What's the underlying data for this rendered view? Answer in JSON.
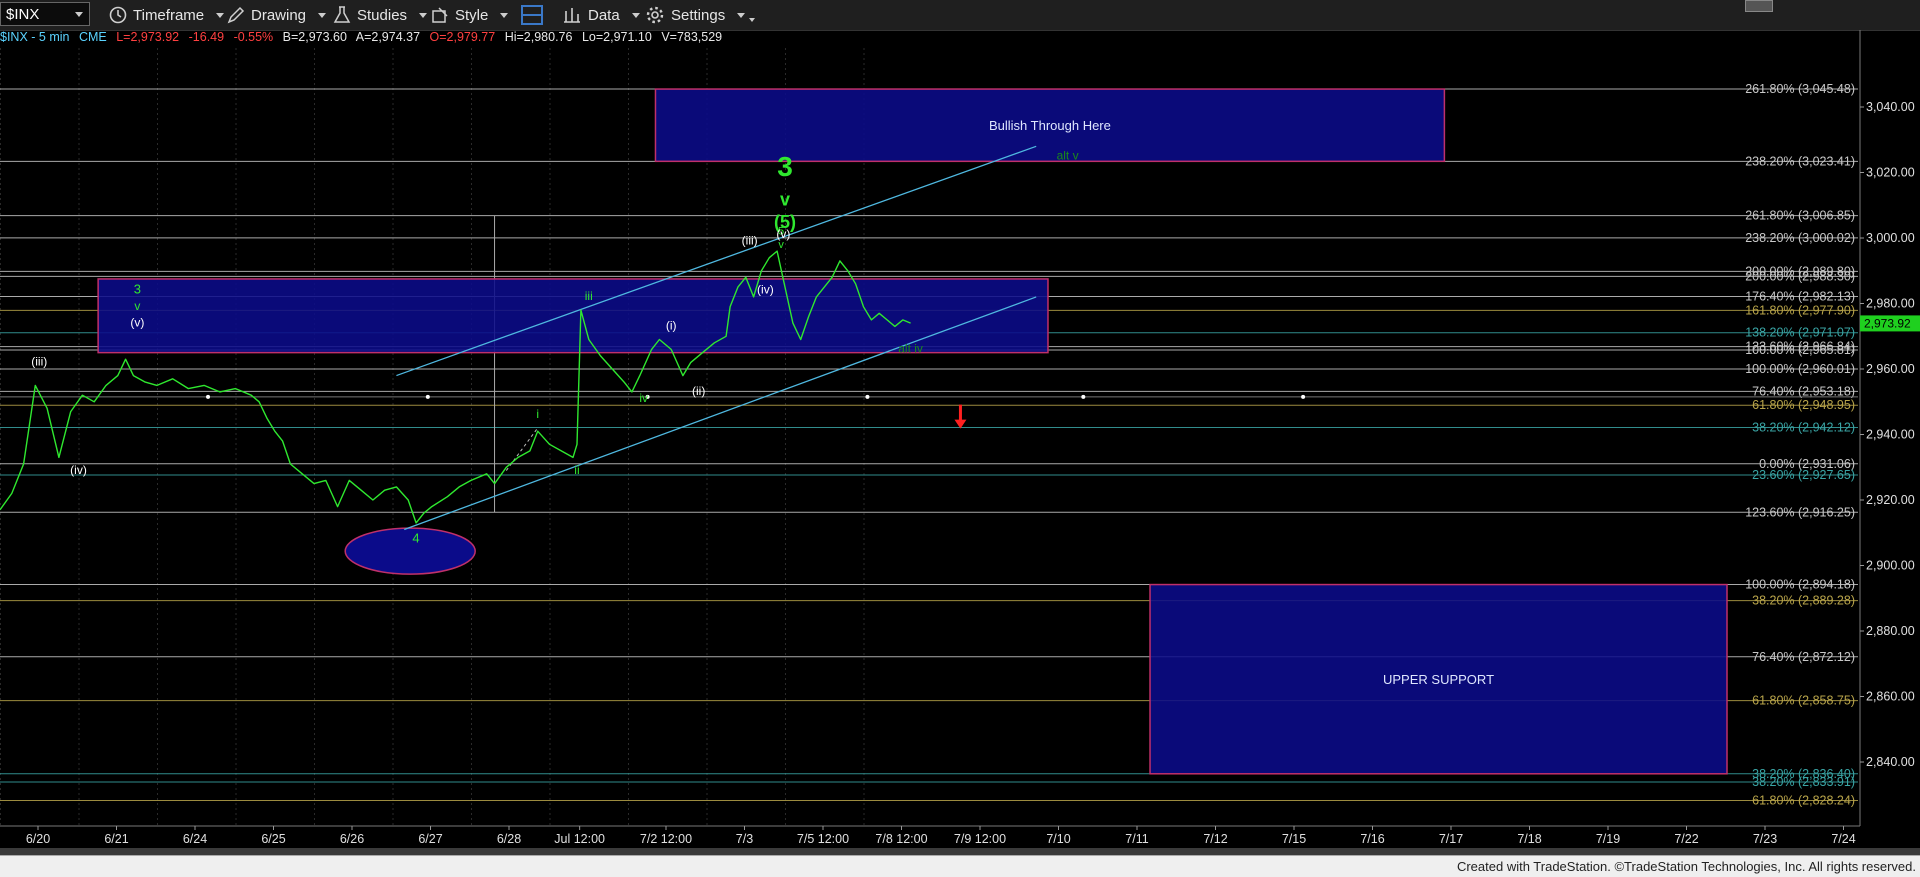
{
  "toolbar": {
    "symbol": "$INX",
    "timeframe": "Timeframe",
    "drawing": "Drawing",
    "studies": "Studies",
    "style": "Style",
    "data": "Data",
    "settings": "Settings"
  },
  "infobar": {
    "title": "$INX - 5 min",
    "exchange": "CME",
    "last": "L=2,973.92",
    "change": "-16.49",
    "pct": "-0.55%",
    "bid": "B=2,973.60",
    "ask": "A=2,974.37",
    "open": "O=2,979.77",
    "high": "Hi=2,980.76",
    "low": "Lo=2,971.10",
    "volume": "V=783,529"
  },
  "footer": {
    "credit": "Created with TradeStation. ©TradeStation Technologies, Inc. All rights reserved."
  },
  "colors": {
    "bg": "#000000",
    "price": "#2fe82f",
    "box": "#0b0b8a",
    "boxBorder": "#c0306a",
    "channel": "#4fb8e0",
    "last": "#1fd01f",
    "down": "#ff2020"
  },
  "chart_data": {
    "type": "line",
    "title": "$INX - 5 min",
    "ylim": [
      2826,
      3060
    ],
    "y_ticks": [
      3040,
      3020,
      3000,
      2980,
      2960,
      2940,
      2920,
      2900,
      2880,
      2860,
      2840
    ],
    "y_tick_labels": [
      "3,040.00",
      "3,020.00",
      "3,000.00",
      "2,980.00",
      "2,960.00",
      "2,940.00",
      "2,920.00",
      "2,900.00",
      "2,880.00",
      "2,860.00",
      "2,840.00"
    ],
    "x_ticks": [
      {
        "t": 0.5,
        "label": "6/20"
      },
      {
        "t": 1.5,
        "label": "6/21"
      },
      {
        "t": 2.5,
        "label": "6/24"
      },
      {
        "t": 3.5,
        "label": "6/25"
      },
      {
        "t": 4.5,
        "label": "6/26"
      },
      {
        "t": 5.5,
        "label": "6/27"
      },
      {
        "t": 6.5,
        "label": "6/28"
      },
      {
        "t": 7.4,
        "label": "Jul 12:00"
      },
      {
        "t": 8.5,
        "label": "7/2 12:00"
      },
      {
        "t": 9.5,
        "label": "7/3"
      },
      {
        "t": 10.5,
        "label": "7/5 12:00"
      },
      {
        "t": 11.5,
        "label": "7/8 12:00"
      },
      {
        "t": 12.5,
        "label": "7/9 12:00"
      },
      {
        "t": 13.5,
        "label": "7/10"
      },
      {
        "t": 14.5,
        "label": "7/11"
      },
      {
        "t": 15.5,
        "label": "7/12"
      },
      {
        "t": 16.5,
        "label": "7/15"
      },
      {
        "t": 17.5,
        "label": "7/16"
      },
      {
        "t": 18.5,
        "label": "7/17"
      },
      {
        "t": 19.5,
        "label": "7/18"
      },
      {
        "t": 20.5,
        "label": "7/19"
      },
      {
        "t": 21.5,
        "label": "7/22"
      },
      {
        "t": 22.5,
        "label": "7/23"
      },
      {
        "t": 23.5,
        "label": "7/24"
      }
    ],
    "session_lines": [
      0,
      1,
      2,
      3,
      4,
      5,
      6,
      7,
      8,
      9,
      10,
      11
    ],
    "series": [
      {
        "values": [
          [
            0.0,
            2917
          ],
          [
            0.15,
            2922
          ],
          [
            0.3,
            2931
          ],
          [
            0.45,
            2955
          ],
          [
            0.6,
            2948
          ],
          [
            0.75,
            2933
          ],
          [
            0.9,
            2947
          ],
          [
            1.05,
            2952
          ],
          [
            1.2,
            2950
          ],
          [
            1.35,
            2955
          ],
          [
            1.5,
            2958
          ],
          [
            1.6,
            2963
          ],
          [
            1.7,
            2958
          ],
          [
            1.85,
            2956
          ],
          [
            2.0,
            2955
          ],
          [
            2.2,
            2957
          ],
          [
            2.4,
            2954
          ],
          [
            2.6,
            2955
          ],
          [
            2.8,
            2953
          ],
          [
            3.0,
            2954
          ],
          [
            3.2,
            2952
          ],
          [
            3.3,
            2950
          ],
          [
            3.4,
            2945
          ],
          [
            3.5,
            2941
          ],
          [
            3.6,
            2938
          ],
          [
            3.7,
            2931
          ],
          [
            3.85,
            2928
          ],
          [
            4.0,
            2925
          ],
          [
            4.15,
            2926
          ],
          [
            4.3,
            2918
          ],
          [
            4.45,
            2926
          ],
          [
            4.6,
            2923
          ],
          [
            4.75,
            2920
          ],
          [
            4.9,
            2923
          ],
          [
            5.05,
            2924
          ],
          [
            5.2,
            2920
          ],
          [
            5.3,
            2913
          ],
          [
            5.4,
            2916
          ],
          [
            5.5,
            2918
          ],
          [
            5.7,
            2921
          ],
          [
            5.85,
            2924
          ],
          [
            6.0,
            2926
          ],
          [
            6.2,
            2928
          ],
          [
            6.3,
            2925
          ],
          [
            6.45,
            2930
          ],
          [
            6.6,
            2933
          ],
          [
            6.75,
            2935
          ],
          [
            6.85,
            2941
          ],
          [
            7.0,
            2937
          ],
          [
            7.15,
            2935
          ],
          [
            7.3,
            2933
          ],
          [
            7.35,
            2937
          ],
          [
            7.4,
            2978
          ],
          [
            7.5,
            2969
          ],
          [
            7.65,
            2964
          ],
          [
            7.8,
            2960
          ],
          [
            7.95,
            2956
          ],
          [
            8.05,
            2953
          ],
          [
            8.15,
            2958
          ],
          [
            8.3,
            2966
          ],
          [
            8.4,
            2969
          ],
          [
            8.55,
            2966
          ],
          [
            8.7,
            2958
          ],
          [
            8.8,
            2962
          ],
          [
            8.95,
            2965
          ],
          [
            9.1,
            2968
          ],
          [
            9.25,
            2970
          ],
          [
            9.3,
            2979
          ],
          [
            9.4,
            2985
          ],
          [
            9.5,
            2988
          ],
          [
            9.6,
            2982
          ],
          [
            9.7,
            2990
          ],
          [
            9.8,
            2994
          ],
          [
            9.9,
            2996
          ],
          [
            10.0,
            2985
          ],
          [
            10.1,
            2974
          ],
          [
            10.2,
            2969
          ],
          [
            10.3,
            2976
          ],
          [
            10.4,
            2982
          ],
          [
            10.5,
            2985
          ],
          [
            10.6,
            2988
          ],
          [
            10.7,
            2993
          ],
          [
            10.8,
            2990
          ],
          [
            10.9,
            2986
          ],
          [
            11.0,
            2979
          ],
          [
            11.1,
            2975
          ],
          [
            11.2,
            2977
          ],
          [
            11.3,
            2975
          ],
          [
            11.4,
            2973
          ],
          [
            11.5,
            2975
          ],
          [
            11.6,
            2974
          ]
        ]
      }
    ],
    "last_price": "2,973.92",
    "annotations": [
      {
        "text": "(iii)",
        "t": 0.5,
        "y": 2961,
        "color": "#ffffff",
        "size": 12
      },
      {
        "text": "(iv)",
        "t": 1.0,
        "y": 2928,
        "color": "#ffffff",
        "size": 12
      },
      {
        "text": "3",
        "t": 1.75,
        "y": 2983,
        "color": "#2fe82f",
        "size": 13
      },
      {
        "text": "v",
        "t": 1.75,
        "y": 2978,
        "color": "#2fe82f",
        "size": 12
      },
      {
        "text": "(v)",
        "t": 1.75,
        "y": 2973,
        "color": "#ffffff",
        "size": 12
      },
      {
        "text": "4",
        "t": 5.3,
        "y": 2907,
        "color": "#2fe82f",
        "size": 13
      },
      {
        "text": "i",
        "t": 6.85,
        "y": 2945,
        "color": "#2fe82f",
        "size": 12
      },
      {
        "text": "ii",
        "t": 7.35,
        "y": 2928,
        "color": "#2fe82f",
        "size": 12
      },
      {
        "text": "iii",
        "t": 7.5,
        "y": 2981,
        "color": "#2fe82f",
        "size": 12
      },
      {
        "text": "iv",
        "t": 8.2,
        "y": 2950,
        "color": "#2fe82f",
        "size": 12
      },
      {
        "text": "(i)",
        "t": 8.55,
        "y": 2972,
        "color": "#ffffff",
        "size": 12
      },
      {
        "text": "(ii)",
        "t": 8.9,
        "y": 2952,
        "color": "#ffffff",
        "size": 12
      },
      {
        "text": "(iii)",
        "t": 9.55,
        "y": 2998,
        "color": "#ffffff",
        "size": 12
      },
      {
        "text": "(iv)",
        "t": 9.75,
        "y": 2983,
        "color": "#ffffff",
        "size": 12
      },
      {
        "text": "3",
        "t": 10.0,
        "y": 3019,
        "color": "#2fe82f",
        "size": 28
      },
      {
        "text": "v",
        "t": 10.0,
        "y": 3010,
        "color": "#2fe82f",
        "size": 18
      },
      {
        "text": "(5)",
        "t": 10.0,
        "y": 3003,
        "color": "#2fe82f",
        "size": 18
      },
      {
        "text": "5",
        "t": 9.95,
        "y": 3001,
        "color": "#2fe82f",
        "size": 11
      },
      {
        "text": "v",
        "t": 9.95,
        "y": 2997,
        "color": "#2fe82f",
        "size": 11
      },
      {
        "text": "(v)",
        "t": 9.98,
        "y": 3000,
        "color": "#ffffff",
        "size": 12
      },
      {
        "text": "alt v",
        "t": 13.6,
        "y": 3024,
        "color": "#1a8a1a",
        "size": 12
      },
      {
        "text": "alt iv",
        "t": 11.6,
        "y": 2965,
        "color": "#1a8a1a",
        "size": 12
      }
    ],
    "boxes": [
      {
        "label": "Bullish Through Here",
        "t0": 8.35,
        "t1": 18.4,
        "y0": 3023.41,
        "y1": 3045.48
      },
      {
        "label": "",
        "t0": 1.25,
        "t1": 13.35,
        "y0": 2965,
        "y1": 2987.5
      },
      {
        "label": "UPPER SUPPORT",
        "t0": 14.65,
        "t1": 22.0,
        "y0": 2836.4,
        "y1": 2894.18
      }
    ],
    "fib_levels": [
      {
        "label": "261.80% (3,045.48)",
        "y": 3045.48,
        "color": "#c8c8c8"
      },
      {
        "label": "238.20% (3,023.41)",
        "y": 3023.41,
        "color": "#c8c8c8"
      },
      {
        "label": "261.80% (3,006.85)",
        "y": 3006.85,
        "color": "#c8c8c8"
      },
      {
        "label": "238.20% (3,000.02)",
        "y": 3000.02,
        "color": "#c8c8c8"
      },
      {
        "label": "200.00% (2,989.80)",
        "y": 2989.8,
        "color": "#c8c8c8"
      },
      {
        "label": "200.00% (2,988.30)",
        "y": 2988.3,
        "color": "#c8c8c8"
      },
      {
        "label": "176.40% (2,982.13)",
        "y": 2982.13,
        "color": "#c8c8c8"
      },
      {
        "label": "161.80% (2,977.90)",
        "y": 2977.9,
        "color": "#b8a44a"
      },
      {
        "label": "138.20% (2,971.07)",
        "y": 2971.07,
        "color": "#3aa5a5"
      },
      {
        "label": "123.60% (2,966.84)",
        "y": 2966.84,
        "color": "#c8c8c8"
      },
      {
        "label": "100.00% (2,965.81)",
        "y": 2965.81,
        "color": "#c8c8c8"
      },
      {
        "label": "100.00% (2,960.01)",
        "y": 2960.01,
        "color": "#c8c8c8"
      },
      {
        "label": "76.40% (2,953.18)",
        "y": 2953.18,
        "color": "#c8c8c8"
      },
      {
        "label": "61.80% (2,948.95)",
        "y": 2948.95,
        "color": "#b8a44a"
      },
      {
        "label": "38.20% (2,942.12)",
        "y": 2942.12,
        "color": "#3aa5a5"
      },
      {
        "label": "0.00% (2,931.06)",
        "y": 2931.06,
        "color": "#c8c8c8"
      },
      {
        "label": "23.60% (2,927.65)",
        "y": 2927.65,
        "color": "#3aa5a5"
      },
      {
        "label": "123.60% (2,916.25)",
        "y": 2916.25,
        "color": "#c8c8c8"
      },
      {
        "label": "100.00% (2,894.18)",
        "y": 2894.18,
        "color": "#c8c8c8"
      },
      {
        "label": "38.20% (2,889.28)",
        "y": 2889.28,
        "color": "#b8a44a"
      },
      {
        "label": "76.40% (2,872.12)",
        "y": 2872.12,
        "color": "#c8c8c8"
      },
      {
        "label": "61.80% (2,858.75)",
        "y": 2858.75,
        "color": "#b8a44a"
      },
      {
        "label": "38.20% (2,836.40)",
        "y": 2836.4,
        "color": "#3aa5a5"
      },
      {
        "label": "38.20% (2,833.91)",
        "y": 2833.91,
        "color": "#3aa5a5"
      },
      {
        "label": "61.80% (2,828.24)",
        "y": 2828.24,
        "color": "#b8a44a"
      }
    ],
    "channel": [
      {
        "t0": 5.15,
        "y0": 2911,
        "t1": 13.2,
        "y1": 2982
      },
      {
        "t0": 5.05,
        "y0": 2958,
        "t1": 13.2,
        "y1": 3028
      }
    ],
    "target_ellipse": {
      "t": 5.2,
      "y": 2905,
      "color": "#0b0b8a"
    },
    "down_arrow": {
      "t": 12.2,
      "y": 2943
    }
  }
}
